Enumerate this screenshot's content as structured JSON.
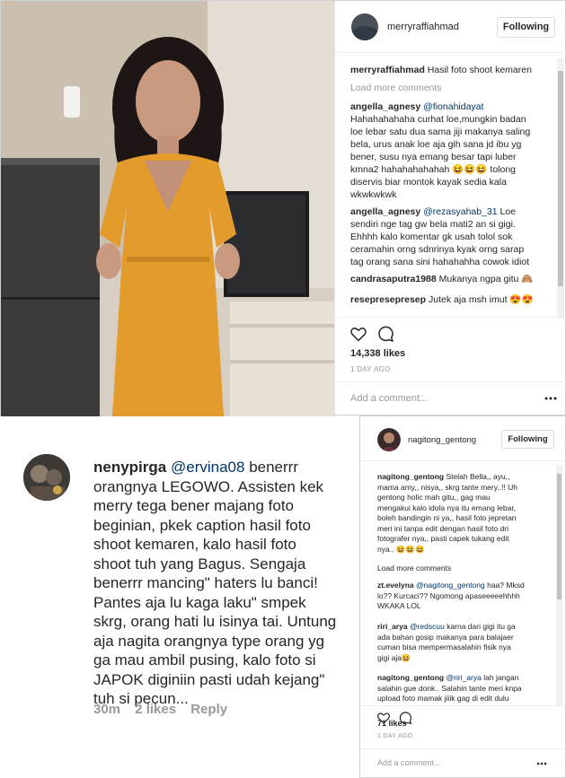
{
  "post1": {
    "username": "merryraffiahmad",
    "follow_label": "Following",
    "caption_user": "merryraffiahmad",
    "caption_text": "Hasil foto shoot kemaren",
    "load_more": "Load more comments",
    "comments": [
      {
        "user": "angella_agnesy",
        "mention": "@fionahidayat",
        "l1": "Hahahahahaha curhat loe,mungkin badan",
        "l2": "loe lebar satu dua sama jiji makanya saling",
        "l3": "bela, urus anak loe aja gih sana jd ibu yg",
        "l4": "bener, susu nya emang besar tapi luber",
        "l5": "kmna2 hahahahahahah 😆😆😆 tolong",
        "l6": "diservis biar montok kayak sedia kala",
        "l7": "wkwkwkwk"
      },
      {
        "user": "angella_agnesy",
        "mention": "@rezasyahab_31",
        "l0": "Loe",
        "l1": "sendiri nge tag gw bela mati2 an si gigi.",
        "l2": "Ehhhh kalo komentar gk usah tolol sok",
        "l3": "ceramahin orng sdnrinya kyak orng sarap",
        "l4": "tag orang sana sini hahahahha cowok idiot"
      },
      {
        "user": "candrasaputra1988",
        "text": "Mukanya ngpa gitu 🙈"
      },
      {
        "user": "reseprese presep",
        "text": ""
      },
      {
        "user": "resepresepresep",
        "text": "Jutek aja msh imut 😍😍"
      }
    ],
    "likes": "14,338 likes",
    "time": "1 DAY AGO",
    "add_comment": "Add a comment..."
  },
  "comment_card": {
    "user": "nenypirga",
    "mention": "@ervina08",
    "lines": [
      "benerrr",
      "orangnya LEGOWO. Assisten kek",
      "merry tega bener majang foto",
      "beginian, pkek caption hasil foto",
      "shoot kemaren, kalo hasil foto",
      "shoot tuh yang Bagus. Sengaja",
      "benerrr mancing\" haters lu banci!",
      "Pantes aja lu kaga laku\" smpek",
      "skrg, orang hati lu isinya tai. Untung",
      "aja nagita orangnya type orang yg",
      "ga mau ambil pusing,  kalo foto si",
      "JAPOK diginiin pasti udah kejang\"",
      "tuh si pecun..."
    ],
    "time": "30m",
    "likes": "2 likes",
    "reply": "Reply"
  },
  "post2": {
    "username": "nagitong_gentong",
    "follow_label": "Following",
    "caption_user": "nagitong_gentong",
    "caption_lines": [
      "Stelah Bella,, ayu,,",
      "mama amy,, nisya,, skrg tante mery..!! Uh",
      "gentong holic mah gitu,, gag mau",
      "mengakui kalo idola nya itu emang lebar,",
      "boleh bandingin ni ya,, hasil foto jepretan",
      "meri ini tanpa edit dengan hasil foto dri",
      "fotografer nya,, pasti capek tukang edit",
      "nya.. 😆😆😆"
    ],
    "load_more": "Load more comments",
    "comments": [
      {
        "user": "zt.evelyna",
        "mention": "@nagitong_gentong",
        "l0": "haa? Mksd",
        "l1": "lo?? Kurcaci?? Ngomong apaseeeeehhhh",
        "l2": "WKAKA LOL"
      },
      {
        "user": "riri_arya",
        "mention": "@redscuu",
        "l0": "karna dari gigi itu ga",
        "l1": "ada bahan gosip makanya para balajaer",
        "l2": "cuman bisa mempermasalahin fisik nya",
        "l3": "gigi aja😆"
      },
      {
        "user": "nagitong_gentong",
        "mention": "@riri_arya",
        "l0": "lah jangan",
        "l1": "salahin gue donk.. Salahin tante meri knpa",
        "l2": "upload foto mamak jiiik gag di edit dulu"
      }
    ],
    "likes": "71 likes",
    "time": "1 DAY AGO",
    "add_comment": "Add a comment..."
  }
}
